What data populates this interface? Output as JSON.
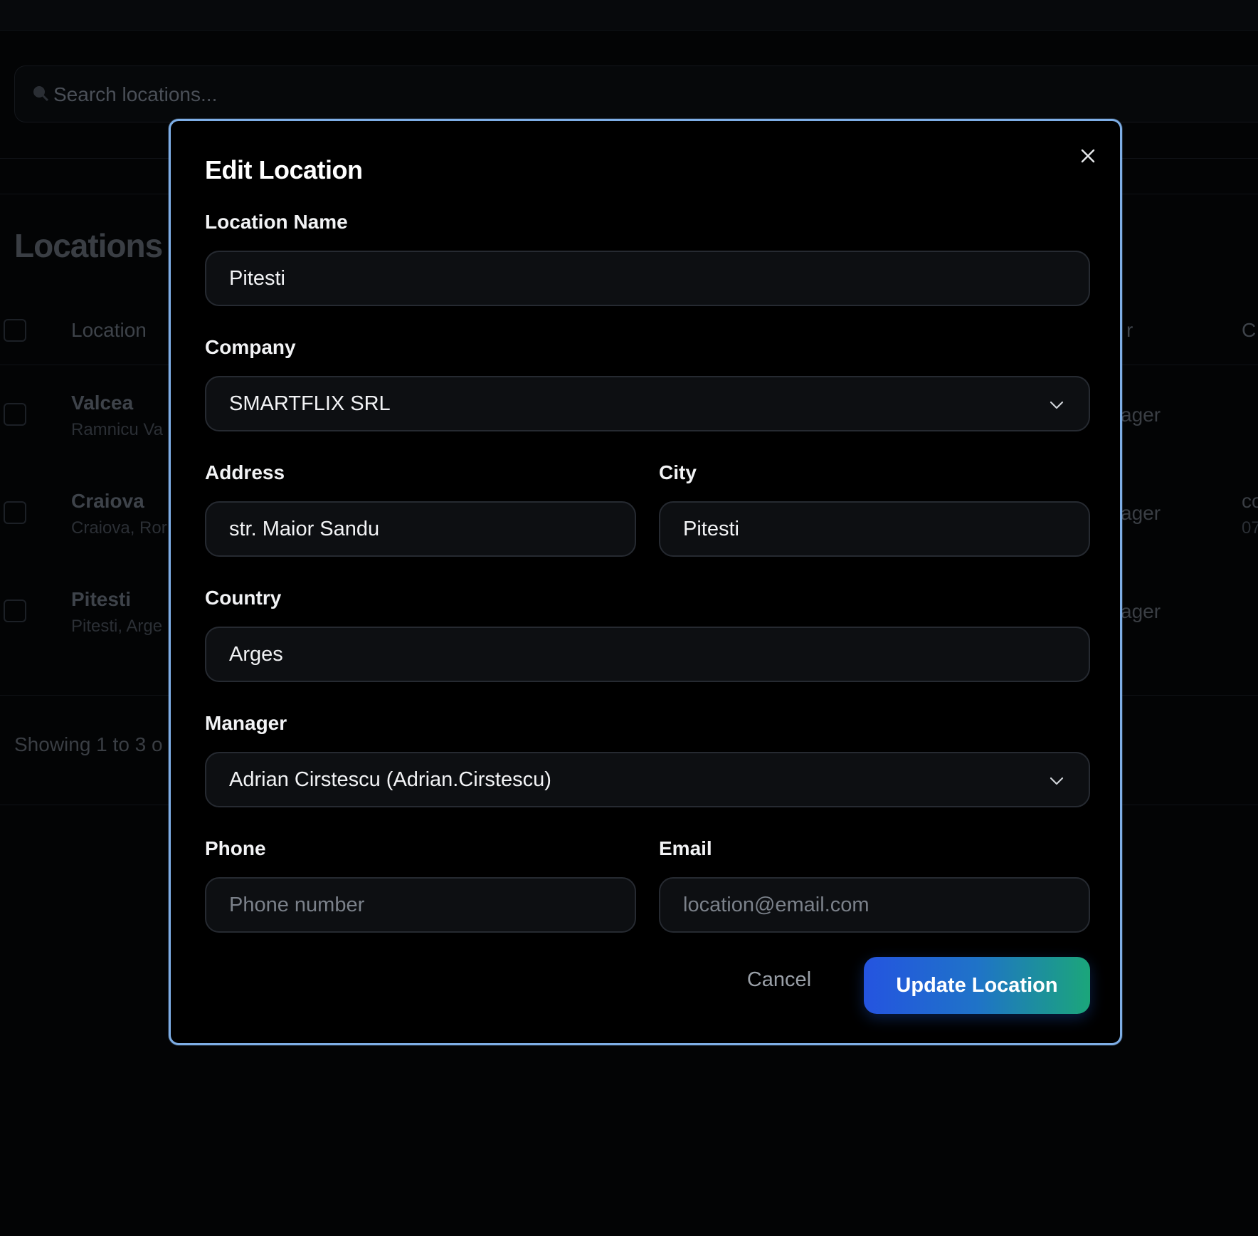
{
  "background": {
    "search_placeholder": "Search locations...",
    "page_title": "Locations",
    "table_header_location": "Location",
    "table_header_manager_partial": "r",
    "table_header_contact_partial": "C",
    "rows": [
      {
        "name": "Valcea",
        "sub": "Ramnicu Va",
        "manager_partial": "ager",
        "right_partial": "",
        "right_sub_partial": ""
      },
      {
        "name": "Craiova",
        "sub": "Craiova, Ror",
        "manager_partial": "ager",
        "right_partial": "co",
        "right_sub_partial": "07"
      },
      {
        "name": "Pitesti",
        "sub": "Pitesti, Arge",
        "manager_partial": "ager",
        "right_partial": "",
        "right_sub_partial": ""
      }
    ],
    "showing_text": "Showing 1 to 3 o"
  },
  "modal": {
    "title": "Edit Location",
    "close_icon": "close-icon",
    "location_name": {
      "label": "Location Name",
      "value": "Pitesti"
    },
    "company": {
      "label": "Company",
      "value": "SMARTFLIX SRL"
    },
    "address": {
      "label": "Address",
      "value": "str. Maior Sandu"
    },
    "city": {
      "label": "City",
      "value": "Pitesti"
    },
    "country": {
      "label": "Country",
      "value": "Arges"
    },
    "manager": {
      "label": "Manager",
      "value": "Adrian Cirstescu (Adrian.Cirstescu)"
    },
    "phone": {
      "label": "Phone",
      "placeholder": "Phone number"
    },
    "email": {
      "label": "Email",
      "placeholder": "location@email.com"
    },
    "cancel_label": "Cancel",
    "update_label": "Update Location"
  },
  "colors": {
    "modal_border": "#7eaee6",
    "update_gradient_start": "#2454e0",
    "update_gradient_end": "#1ba67a"
  }
}
